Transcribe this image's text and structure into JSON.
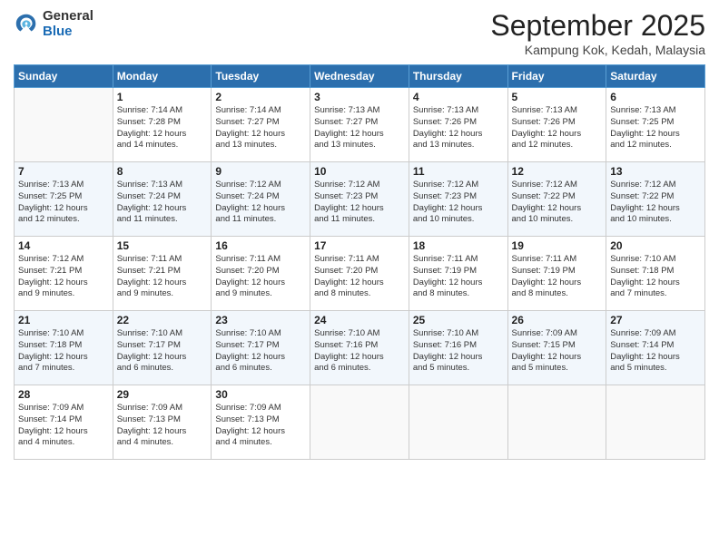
{
  "logo": {
    "general": "General",
    "blue": "Blue"
  },
  "header": {
    "month": "September 2025",
    "location": "Kampung Kok, Kedah, Malaysia"
  },
  "weekdays": [
    "Sunday",
    "Monday",
    "Tuesday",
    "Wednesday",
    "Thursday",
    "Friday",
    "Saturday"
  ],
  "weeks": [
    [
      {
        "day": "",
        "info": ""
      },
      {
        "day": "1",
        "info": "Sunrise: 7:14 AM\nSunset: 7:28 PM\nDaylight: 12 hours\nand 14 minutes."
      },
      {
        "day": "2",
        "info": "Sunrise: 7:14 AM\nSunset: 7:27 PM\nDaylight: 12 hours\nand 13 minutes."
      },
      {
        "day": "3",
        "info": "Sunrise: 7:13 AM\nSunset: 7:27 PM\nDaylight: 12 hours\nand 13 minutes."
      },
      {
        "day": "4",
        "info": "Sunrise: 7:13 AM\nSunset: 7:26 PM\nDaylight: 12 hours\nand 13 minutes."
      },
      {
        "day": "5",
        "info": "Sunrise: 7:13 AM\nSunset: 7:26 PM\nDaylight: 12 hours\nand 12 minutes."
      },
      {
        "day": "6",
        "info": "Sunrise: 7:13 AM\nSunset: 7:25 PM\nDaylight: 12 hours\nand 12 minutes."
      }
    ],
    [
      {
        "day": "7",
        "info": "Sunrise: 7:13 AM\nSunset: 7:25 PM\nDaylight: 12 hours\nand 12 minutes."
      },
      {
        "day": "8",
        "info": "Sunrise: 7:13 AM\nSunset: 7:24 PM\nDaylight: 12 hours\nand 11 minutes."
      },
      {
        "day": "9",
        "info": "Sunrise: 7:12 AM\nSunset: 7:24 PM\nDaylight: 12 hours\nand 11 minutes."
      },
      {
        "day": "10",
        "info": "Sunrise: 7:12 AM\nSunset: 7:23 PM\nDaylight: 12 hours\nand 11 minutes."
      },
      {
        "day": "11",
        "info": "Sunrise: 7:12 AM\nSunset: 7:23 PM\nDaylight: 12 hours\nand 10 minutes."
      },
      {
        "day": "12",
        "info": "Sunrise: 7:12 AM\nSunset: 7:22 PM\nDaylight: 12 hours\nand 10 minutes."
      },
      {
        "day": "13",
        "info": "Sunrise: 7:12 AM\nSunset: 7:22 PM\nDaylight: 12 hours\nand 10 minutes."
      }
    ],
    [
      {
        "day": "14",
        "info": "Sunrise: 7:12 AM\nSunset: 7:21 PM\nDaylight: 12 hours\nand 9 minutes."
      },
      {
        "day": "15",
        "info": "Sunrise: 7:11 AM\nSunset: 7:21 PM\nDaylight: 12 hours\nand 9 minutes."
      },
      {
        "day": "16",
        "info": "Sunrise: 7:11 AM\nSunset: 7:20 PM\nDaylight: 12 hours\nand 9 minutes."
      },
      {
        "day": "17",
        "info": "Sunrise: 7:11 AM\nSunset: 7:20 PM\nDaylight: 12 hours\nand 8 minutes."
      },
      {
        "day": "18",
        "info": "Sunrise: 7:11 AM\nSunset: 7:19 PM\nDaylight: 12 hours\nand 8 minutes."
      },
      {
        "day": "19",
        "info": "Sunrise: 7:11 AM\nSunset: 7:19 PM\nDaylight: 12 hours\nand 8 minutes."
      },
      {
        "day": "20",
        "info": "Sunrise: 7:10 AM\nSunset: 7:18 PM\nDaylight: 12 hours\nand 7 minutes."
      }
    ],
    [
      {
        "day": "21",
        "info": "Sunrise: 7:10 AM\nSunset: 7:18 PM\nDaylight: 12 hours\nand 7 minutes."
      },
      {
        "day": "22",
        "info": "Sunrise: 7:10 AM\nSunset: 7:17 PM\nDaylight: 12 hours\nand 6 minutes."
      },
      {
        "day": "23",
        "info": "Sunrise: 7:10 AM\nSunset: 7:17 PM\nDaylight: 12 hours\nand 6 minutes."
      },
      {
        "day": "24",
        "info": "Sunrise: 7:10 AM\nSunset: 7:16 PM\nDaylight: 12 hours\nand 6 minutes."
      },
      {
        "day": "25",
        "info": "Sunrise: 7:10 AM\nSunset: 7:16 PM\nDaylight: 12 hours\nand 5 minutes."
      },
      {
        "day": "26",
        "info": "Sunrise: 7:09 AM\nSunset: 7:15 PM\nDaylight: 12 hours\nand 5 minutes."
      },
      {
        "day": "27",
        "info": "Sunrise: 7:09 AM\nSunset: 7:14 PM\nDaylight: 12 hours\nand 5 minutes."
      }
    ],
    [
      {
        "day": "28",
        "info": "Sunrise: 7:09 AM\nSunset: 7:14 PM\nDaylight: 12 hours\nand 4 minutes."
      },
      {
        "day": "29",
        "info": "Sunrise: 7:09 AM\nSunset: 7:13 PM\nDaylight: 12 hours\nand 4 minutes."
      },
      {
        "day": "30",
        "info": "Sunrise: 7:09 AM\nSunset: 7:13 PM\nDaylight: 12 hours\nand 4 minutes."
      },
      {
        "day": "",
        "info": ""
      },
      {
        "day": "",
        "info": ""
      },
      {
        "day": "",
        "info": ""
      },
      {
        "day": "",
        "info": ""
      }
    ]
  ]
}
